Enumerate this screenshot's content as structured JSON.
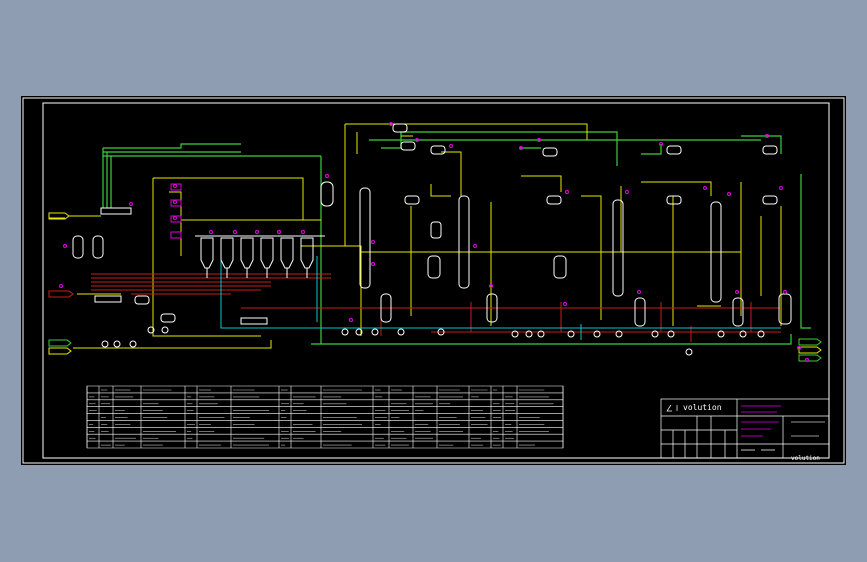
{
  "title_block": {
    "logo_text": "volution",
    "footer_text": "volution"
  },
  "colors": {
    "background": "#8e9db1",
    "sheet": "#000000",
    "frame": "#ffffff",
    "vessel": "#ffffff",
    "yellow_line": "#e8e800",
    "green_line": "#3ccf3c",
    "red_line": "#c81e1e",
    "cyan_line": "#00c8c8",
    "tag_marker": "#e000e0",
    "table_line": "#ffffff"
  }
}
